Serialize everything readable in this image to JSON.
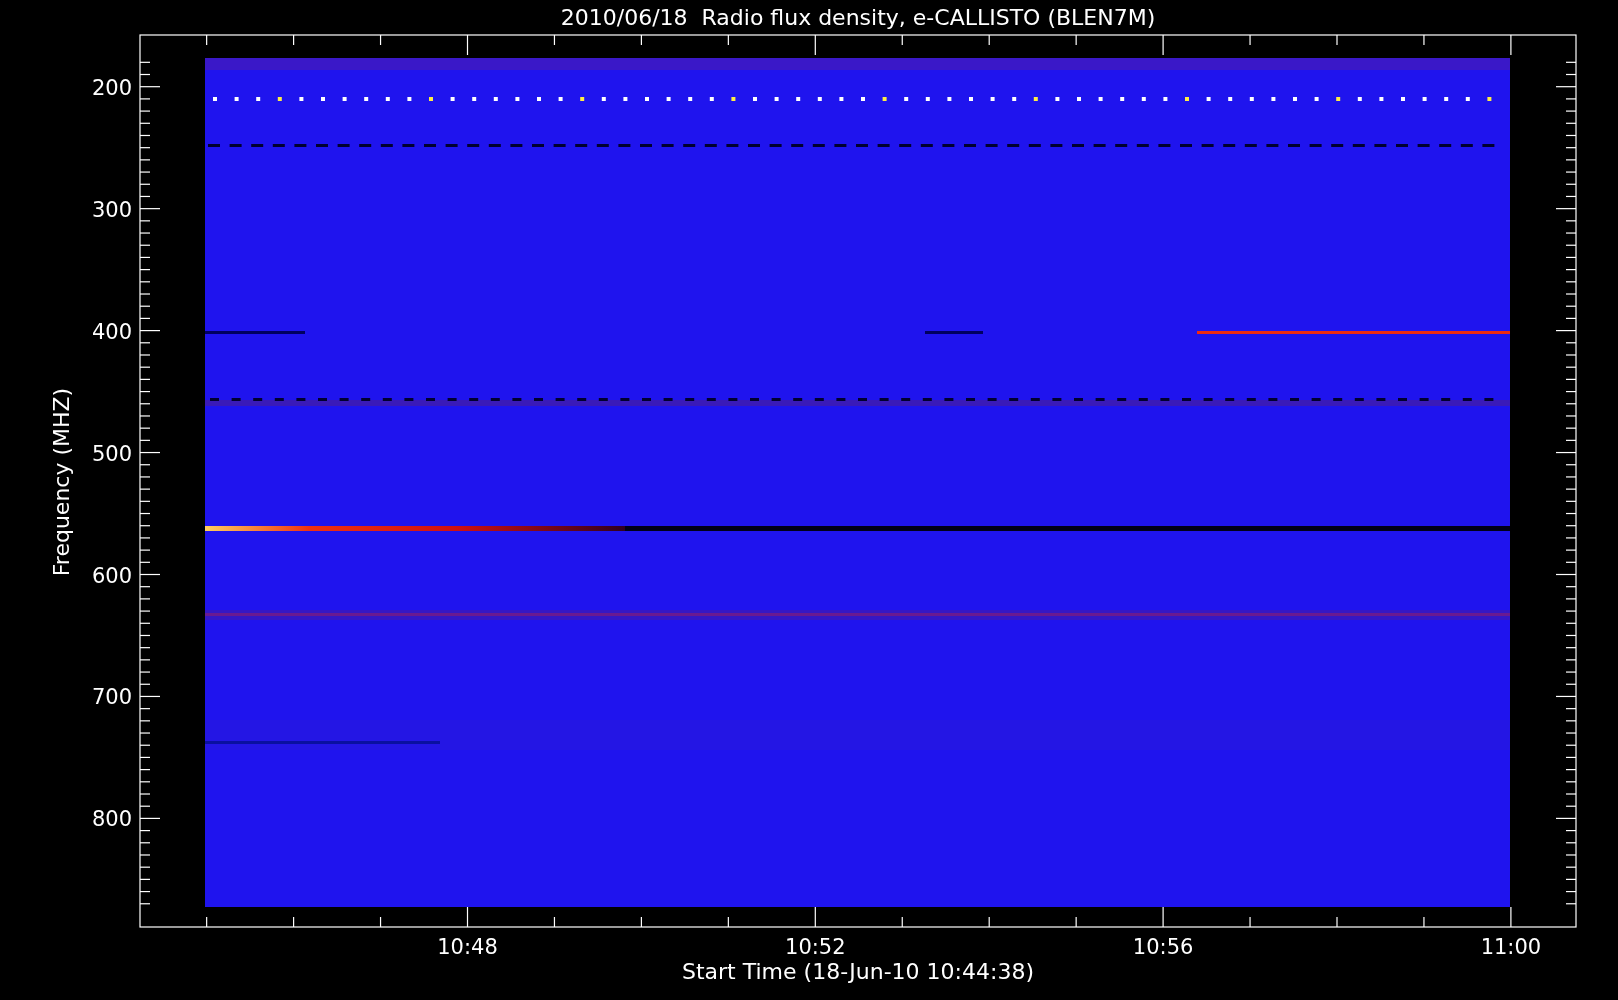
{
  "plot": {
    "title": "2010/06/18  Radio flux density, e-CALLISTO (BLEN7M)",
    "y_axis": {
      "label": "Frequency (MHZ)",
      "ticks": [
        "200",
        "300",
        "400",
        "500",
        "600",
        "700",
        "800"
      ]
    },
    "x_axis": {
      "label": "Start Time (18-Jun-10 10:44:38)",
      "ticks": [
        "10:48",
        "10:52",
        "10:56",
        "11:00"
      ]
    }
  }
}
